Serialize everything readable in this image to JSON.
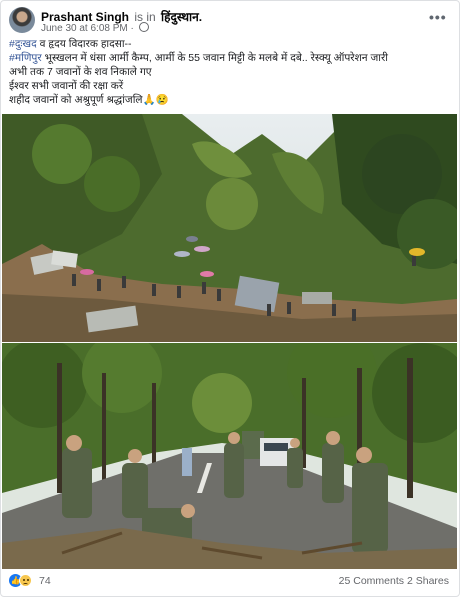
{
  "post": {
    "author": "Prashant Singh",
    "is_in": "is in",
    "place": "हिंदुस्थान.",
    "timestamp": "June 30 at 6:08 PM",
    "privacy_icon": "globe-icon",
    "more_label": "•••"
  },
  "text": {
    "line1_hash": "#दुःखद",
    "line1_rest": " व हृदय विदारक हादसा--",
    "line2_hash": "#मणिपुर",
    "line2_rest": " भूस्खलन में धंसा आर्मी कैम्प, आर्मी के 55 जवान मिट्टी के मलबे में दबे.. रेस्क्यू ऑपरेशन जारी",
    "line3": "अभी तक 7 जवानों के शव निकाले गए",
    "line4": "ईश्वर सभी जवानों की रक्षा करें",
    "line5": "शहीद जवानों को अश्रुपूर्ण श्रद्धांजलि🙏😢"
  },
  "footer": {
    "reaction_icons": [
      "like-icon",
      "sad-icon"
    ],
    "reaction_count": "74",
    "comments": "25 Comments",
    "shares": "2 Shares"
  },
  "colors": {
    "link": "#385898",
    "meta": "#65676b",
    "like_blue": "#1877f2"
  }
}
